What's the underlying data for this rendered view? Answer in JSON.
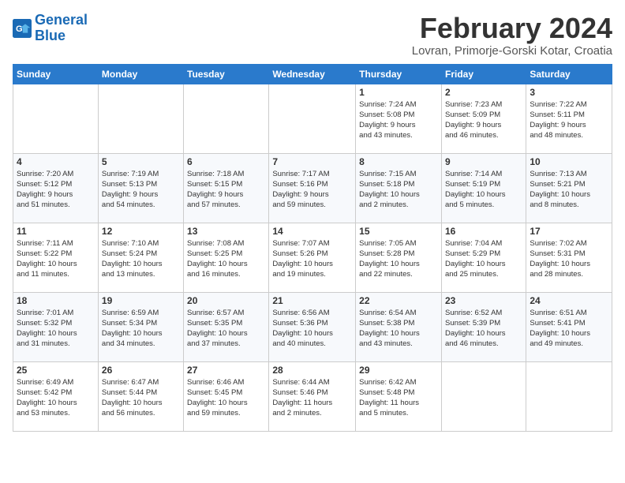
{
  "logo": {
    "line1": "General",
    "line2": "Blue"
  },
  "title": "February 2024",
  "subtitle": "Lovran, Primorje-Gorski Kotar, Croatia",
  "days_header": [
    "Sunday",
    "Monday",
    "Tuesday",
    "Wednesday",
    "Thursday",
    "Friday",
    "Saturday"
  ],
  "weeks": [
    [
      {
        "num": "",
        "detail": ""
      },
      {
        "num": "",
        "detail": ""
      },
      {
        "num": "",
        "detail": ""
      },
      {
        "num": "",
        "detail": ""
      },
      {
        "num": "1",
        "detail": "Sunrise: 7:24 AM\nSunset: 5:08 PM\nDaylight: 9 hours\nand 43 minutes."
      },
      {
        "num": "2",
        "detail": "Sunrise: 7:23 AM\nSunset: 5:09 PM\nDaylight: 9 hours\nand 46 minutes."
      },
      {
        "num": "3",
        "detail": "Sunrise: 7:22 AM\nSunset: 5:11 PM\nDaylight: 9 hours\nand 48 minutes."
      }
    ],
    [
      {
        "num": "4",
        "detail": "Sunrise: 7:20 AM\nSunset: 5:12 PM\nDaylight: 9 hours\nand 51 minutes."
      },
      {
        "num": "5",
        "detail": "Sunrise: 7:19 AM\nSunset: 5:13 PM\nDaylight: 9 hours\nand 54 minutes."
      },
      {
        "num": "6",
        "detail": "Sunrise: 7:18 AM\nSunset: 5:15 PM\nDaylight: 9 hours\nand 57 minutes."
      },
      {
        "num": "7",
        "detail": "Sunrise: 7:17 AM\nSunset: 5:16 PM\nDaylight: 9 hours\nand 59 minutes."
      },
      {
        "num": "8",
        "detail": "Sunrise: 7:15 AM\nSunset: 5:18 PM\nDaylight: 10 hours\nand 2 minutes."
      },
      {
        "num": "9",
        "detail": "Sunrise: 7:14 AM\nSunset: 5:19 PM\nDaylight: 10 hours\nand 5 minutes."
      },
      {
        "num": "10",
        "detail": "Sunrise: 7:13 AM\nSunset: 5:21 PM\nDaylight: 10 hours\nand 8 minutes."
      }
    ],
    [
      {
        "num": "11",
        "detail": "Sunrise: 7:11 AM\nSunset: 5:22 PM\nDaylight: 10 hours\nand 11 minutes."
      },
      {
        "num": "12",
        "detail": "Sunrise: 7:10 AM\nSunset: 5:24 PM\nDaylight: 10 hours\nand 13 minutes."
      },
      {
        "num": "13",
        "detail": "Sunrise: 7:08 AM\nSunset: 5:25 PM\nDaylight: 10 hours\nand 16 minutes."
      },
      {
        "num": "14",
        "detail": "Sunrise: 7:07 AM\nSunset: 5:26 PM\nDaylight: 10 hours\nand 19 minutes."
      },
      {
        "num": "15",
        "detail": "Sunrise: 7:05 AM\nSunset: 5:28 PM\nDaylight: 10 hours\nand 22 minutes."
      },
      {
        "num": "16",
        "detail": "Sunrise: 7:04 AM\nSunset: 5:29 PM\nDaylight: 10 hours\nand 25 minutes."
      },
      {
        "num": "17",
        "detail": "Sunrise: 7:02 AM\nSunset: 5:31 PM\nDaylight: 10 hours\nand 28 minutes."
      }
    ],
    [
      {
        "num": "18",
        "detail": "Sunrise: 7:01 AM\nSunset: 5:32 PM\nDaylight: 10 hours\nand 31 minutes."
      },
      {
        "num": "19",
        "detail": "Sunrise: 6:59 AM\nSunset: 5:34 PM\nDaylight: 10 hours\nand 34 minutes."
      },
      {
        "num": "20",
        "detail": "Sunrise: 6:57 AM\nSunset: 5:35 PM\nDaylight: 10 hours\nand 37 minutes."
      },
      {
        "num": "21",
        "detail": "Sunrise: 6:56 AM\nSunset: 5:36 PM\nDaylight: 10 hours\nand 40 minutes."
      },
      {
        "num": "22",
        "detail": "Sunrise: 6:54 AM\nSunset: 5:38 PM\nDaylight: 10 hours\nand 43 minutes."
      },
      {
        "num": "23",
        "detail": "Sunrise: 6:52 AM\nSunset: 5:39 PM\nDaylight: 10 hours\nand 46 minutes."
      },
      {
        "num": "24",
        "detail": "Sunrise: 6:51 AM\nSunset: 5:41 PM\nDaylight: 10 hours\nand 49 minutes."
      }
    ],
    [
      {
        "num": "25",
        "detail": "Sunrise: 6:49 AM\nSunset: 5:42 PM\nDaylight: 10 hours\nand 53 minutes."
      },
      {
        "num": "26",
        "detail": "Sunrise: 6:47 AM\nSunset: 5:44 PM\nDaylight: 10 hours\nand 56 minutes."
      },
      {
        "num": "27",
        "detail": "Sunrise: 6:46 AM\nSunset: 5:45 PM\nDaylight: 10 hours\nand 59 minutes."
      },
      {
        "num": "28",
        "detail": "Sunrise: 6:44 AM\nSunset: 5:46 PM\nDaylight: 11 hours\nand 2 minutes."
      },
      {
        "num": "29",
        "detail": "Sunrise: 6:42 AM\nSunset: 5:48 PM\nDaylight: 11 hours\nand 5 minutes."
      },
      {
        "num": "",
        "detail": ""
      },
      {
        "num": "",
        "detail": ""
      }
    ]
  ]
}
